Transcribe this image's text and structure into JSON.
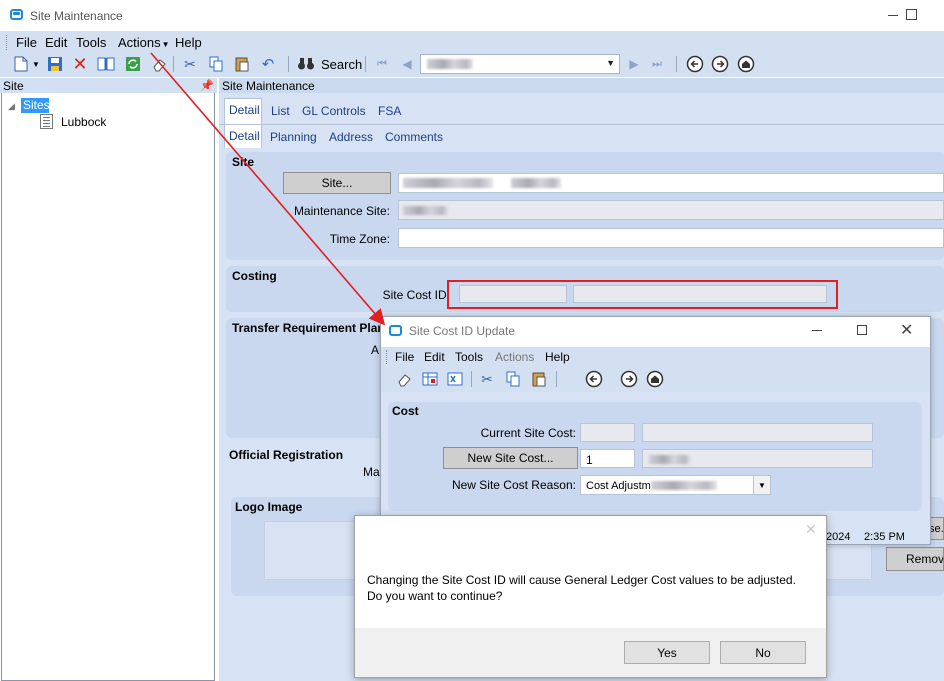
{
  "window": {
    "title": "Site Maintenance"
  },
  "menu": [
    "File",
    "Edit",
    "Tools",
    "Actions",
    "Help"
  ],
  "toolbar": {
    "search_label": "Search"
  },
  "left_panel": {
    "header": "Site",
    "tree_root": "Sites",
    "tree_child": "Lubbock"
  },
  "content": {
    "header": "Site Maintenance",
    "tabs_row1": [
      "Detail",
      "List",
      "GL Controls",
      "FSA"
    ],
    "tabs_row2": [
      "Detail",
      "Planning",
      "Address",
      "Comments"
    ],
    "site_section": {
      "title": "Site",
      "site_button": "Site...",
      "maintenance_site_label": "Maintenance Site:",
      "time_zone_label": "Time Zone:"
    },
    "costing_section": {
      "title": "Costing",
      "site_cost_id_label": "Site Cost ID:"
    },
    "transfer_section": {
      "title": "Transfer Requirement Plann",
      "fragment": "A"
    },
    "official_section": {
      "title": "Official Registration",
      "fragment": "Ma"
    },
    "logo_section": {
      "title": "Logo Image"
    },
    "right_fragments": {
      "browse": "se.",
      "remove": "Remov"
    }
  },
  "dialog": {
    "title": "Site Cost ID Update",
    "menu": [
      "File",
      "Edit",
      "Tools",
      "Actions",
      "Help"
    ],
    "section_title": "Cost",
    "current_site_cost_label": "Current Site Cost:",
    "new_site_cost_button": "New Site Cost...",
    "new_site_cost_value": "1",
    "reason_label": "New Site Cost Reason:",
    "reason_value": "Cost Adjustm",
    "date_fragment": "2024",
    "time_fragment": "2:35 PM"
  },
  "message": {
    "line1": "Changing the Site Cost ID will cause General Ledger Cost values to be adjusted.",
    "line2": "Do you want to continue?",
    "yes": "Yes",
    "no": "No"
  },
  "colors": {
    "accent": "#1e88d8",
    "annotation_red": "#e02020",
    "panel_bg": "#d3e0f2",
    "section_bg": "#c9d8ee",
    "selection": "#3399ff"
  }
}
